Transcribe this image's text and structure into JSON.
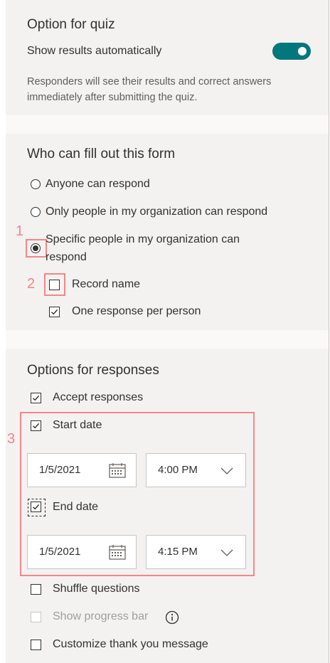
{
  "quiz": {
    "heading": "Option for quiz",
    "show_results_label": "Show results automatically",
    "show_results_on": true,
    "description": "Responders will see their results and correct answers immediately after submitting the quiz."
  },
  "who": {
    "heading": "Who can fill out this form",
    "options": [
      {
        "label": "Anyone can respond",
        "selected": false
      },
      {
        "label": "Only people in my organization can respond",
        "selected": false
      },
      {
        "label_line1": "Specific people in my organization can",
        "label_line2": "respond",
        "selected": true
      }
    ],
    "record_name_label": "Record name",
    "record_name_checked": false,
    "one_response_label": "One response per person",
    "one_response_checked": true
  },
  "responses": {
    "heading": "Options for responses",
    "accept_label": "Accept responses",
    "start_date_label": "Start date",
    "start_date_value": "1/5/2021",
    "start_time_value": "4:00 PM",
    "end_date_label": "End date",
    "end_date_value": "1/5/2021",
    "end_time_value": "4:15 PM",
    "shuffle_label": "Shuffle questions",
    "progress_label": "Show progress bar",
    "thankyou_label": "Customize thank you message"
  },
  "annotations": {
    "n1": "1",
    "n2": "2",
    "n3": "3",
    "color": "#f4868a"
  },
  "colors": {
    "toggle_on": "#03787c",
    "section_bg": "#f3f2f1"
  }
}
